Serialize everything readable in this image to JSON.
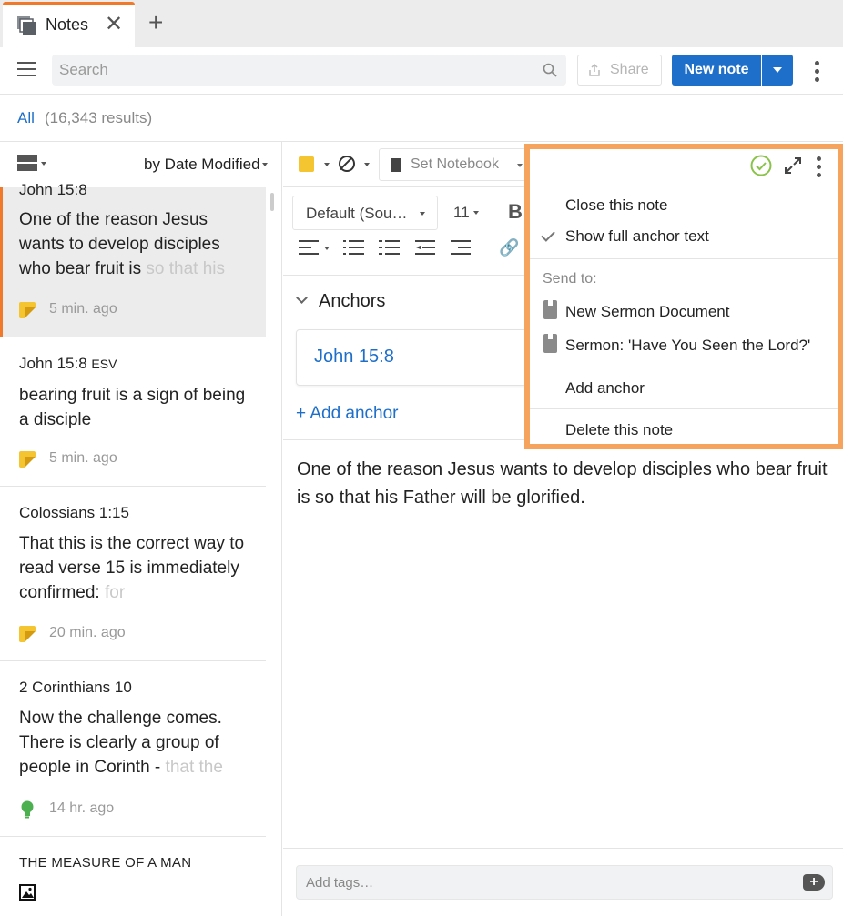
{
  "tab": {
    "label": "Notes",
    "close": "✕",
    "add": "+"
  },
  "toolbar": {
    "search_placeholder": "Search",
    "share_label": "Share",
    "new_note_label": "New note"
  },
  "results": {
    "all_label": "All",
    "count_text": "(16,343 results)"
  },
  "list": {
    "sort_label": "by Date Modified",
    "notes": [
      {
        "title": "John 15:8",
        "body_plain": "One of the reason Jesus wants to develop disciples who bear fruit is",
        "body_faded": "so that his",
        "time": "5 min. ago",
        "kind": "sticky"
      },
      {
        "title": "John 15:8",
        "title_suffix": "ESV",
        "body_plain": "bearing fruit is a sign of being a disciple",
        "body_faded": "",
        "time": "5 min. ago",
        "kind": "sticky"
      },
      {
        "title": "Colossians 1:15",
        "body_plain": "That this is the correct way to read verse 15 is immediately confirmed:",
        "body_faded": "for",
        "time": "20 min. ago",
        "kind": "sticky"
      },
      {
        "title": "2 Corinthians 10",
        "body_plain": "Now the challenge comes. There is clearly a group of people in Corinth -",
        "body_faded": "that the",
        "time": "14 hr. ago",
        "kind": "bulb"
      },
      {
        "title": "THE MEASURE OF A MAN",
        "kind": "image"
      }
    ]
  },
  "editor": {
    "notebook_label": "Set Notebook",
    "font_label": "Default (Sou…",
    "font_size": "11",
    "bold_label": "B",
    "link_glyph": "🔗",
    "anchors_heading": "Anchors",
    "anchor_ref": "John 15:8",
    "add_anchor_label": "+ Add anchor",
    "content": "One of the reason Jesus wants to develop disciples who bear fruit is so that his Father will be glorified.",
    "tags_placeholder": "Add tags…",
    "tags_add_glyph": "+"
  },
  "menu": {
    "close_note": "Close this note",
    "show_full_anchor": "Show full anchor text",
    "send_to_label": "Send to:",
    "send_targets": [
      "New Sermon Document",
      "Sermon: 'Have You Seen the Lord?'"
    ],
    "add_anchor": "Add anchor",
    "delete_note": "Delete this note"
  },
  "colors": {
    "accent": "#1e6fc9",
    "tab_indicator": "#f07a2a",
    "highlight_frame": "#f5a35d",
    "note_yellow": "#f5c431",
    "saved_green": "#8bc34a",
    "bulb_green": "#4caf50"
  }
}
